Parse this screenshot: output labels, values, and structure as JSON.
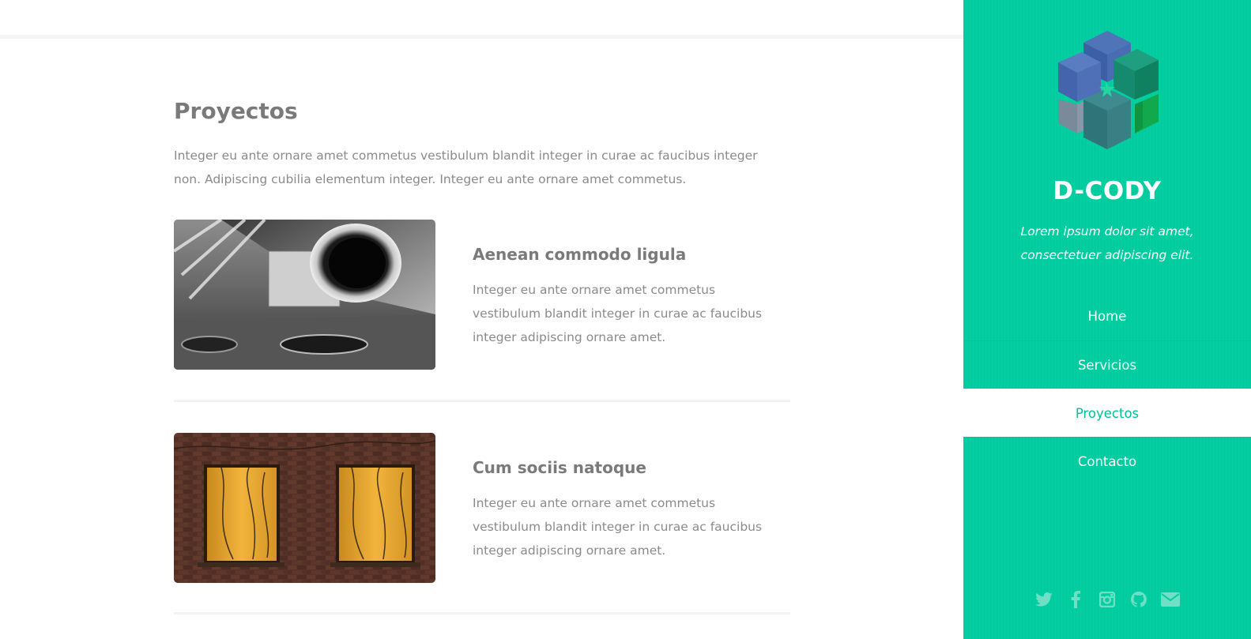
{
  "main": {
    "title": "Proyectos",
    "intro": "Integer eu ante ornare amet commetus vestibulum blandit integer in curae ac faucibus integer non. Adipiscing cubilia elementum integer. Integer eu ante ornare amet commetus.",
    "projects": [
      {
        "title": "Aenean commodo ligula",
        "text": "Integer eu ante ornare amet commetus vestibulum blandit integer in curae ac faucibus integer adipiscing ornare amet."
      },
      {
        "title": "Cum sociis natoque",
        "text": "Integer eu ante ornare amet commetus vestibulum blandit integer in curae ac faucibus integer adipiscing ornare amet."
      }
    ]
  },
  "sidebar": {
    "brand": "D-CODY",
    "tagline": "Lorem ipsum dolor sit amet, consectetuer adipiscing elit.",
    "nav": [
      "Home",
      "Servicios",
      "Proyectos",
      "Contacto"
    ],
    "active_nav": "Proyectos",
    "social_icons": [
      "twitter-icon",
      "facebook-icon",
      "instagram-icon",
      "github-icon",
      "envelope-icon"
    ]
  },
  "colors": {
    "sidebar_bg": "#00cc9f",
    "accent": "#00c195",
    "heading": "#7a7a7a",
    "body_text": "#8a8a8a",
    "social_icon": "#6fe0c6"
  }
}
